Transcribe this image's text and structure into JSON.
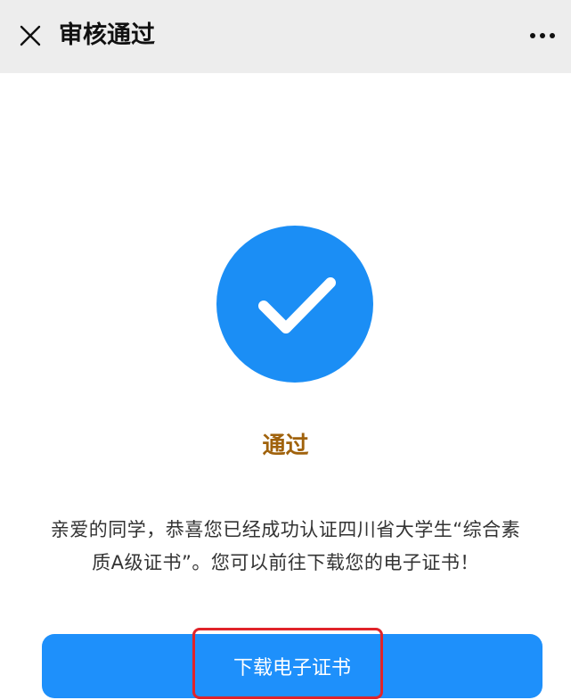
{
  "header": {
    "close_icon": "close-icon",
    "title": "审核通过",
    "more_icon": "more-icon"
  },
  "result": {
    "icon": "checkmark-icon",
    "status": "通过",
    "message": "亲爱的同学，恭喜您已经成功认证四川省大学生“综合素质A级证书”。您可以前往下载您的电子证书！"
  },
  "actions": {
    "download_label": "下载电子证书"
  },
  "colors": {
    "header_bg": "#ededed",
    "accent_blue": "#1e90fb",
    "status_color": "#a0620c",
    "highlight_red": "#e0242a"
  }
}
